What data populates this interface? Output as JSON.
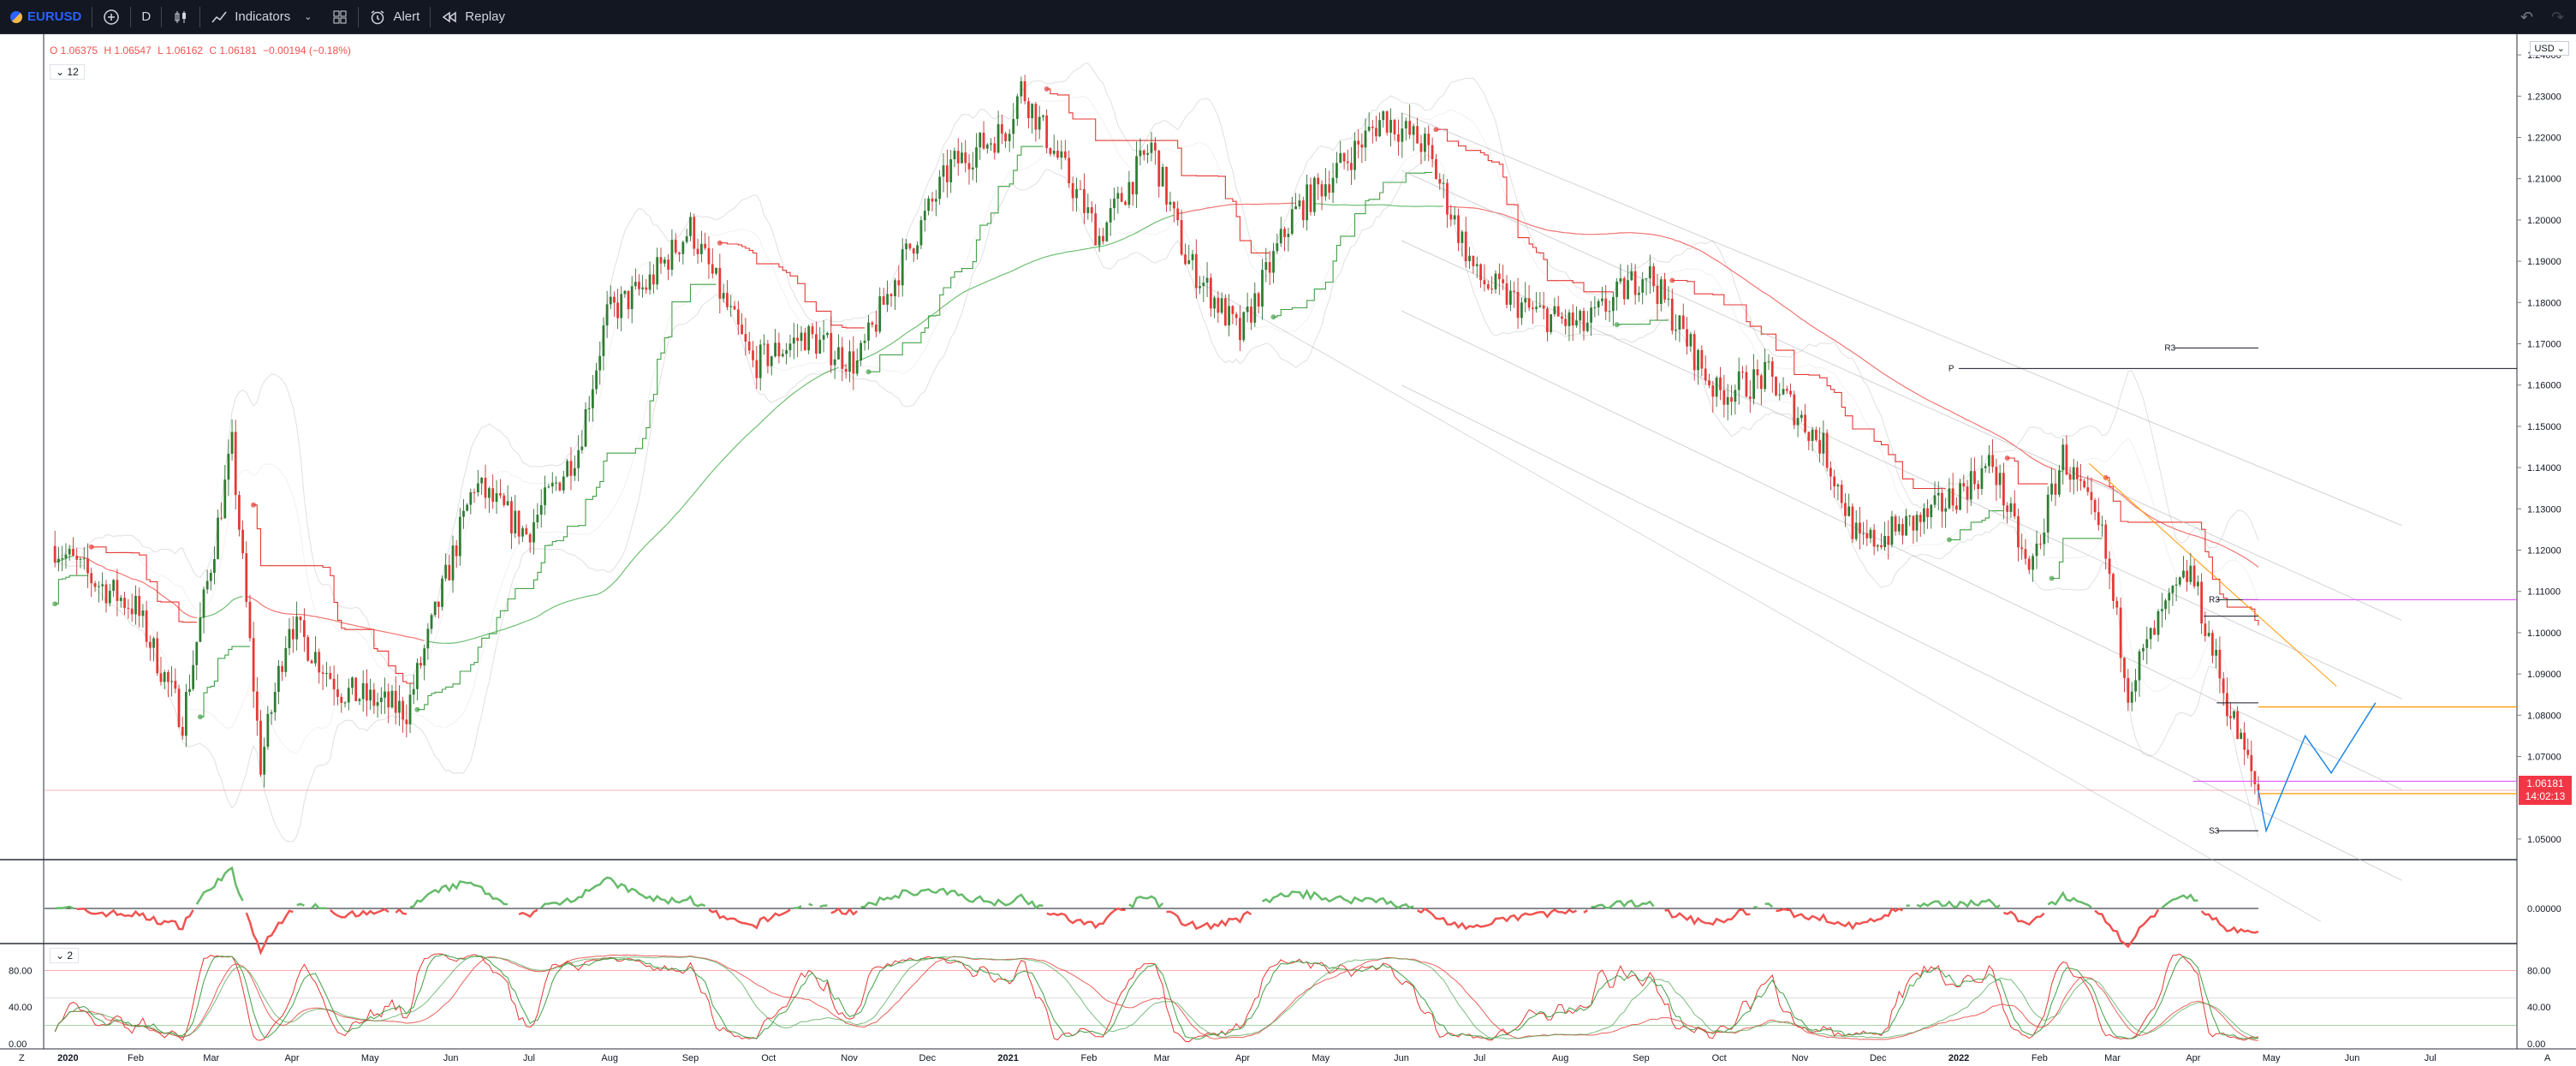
{
  "toolbar": {
    "symbol": "EURUSD",
    "interval": "D",
    "indicators_label": "Indicators",
    "alert_label": "Alert",
    "replay_label": "Replay"
  },
  "ohlc": {
    "o": "O 1.06375",
    "h": "H 1.06547",
    "l": "L 1.06162",
    "c": "C 1.06181",
    "chg": "−0.00194 (−0.18%)"
  },
  "legend_badge_main": "12",
  "legend_badge_stoch": "2",
  "currency": "USD",
  "last_price": {
    "value": "1.06181",
    "countdown": "14:02:13"
  },
  "colors": {
    "up": "#26a69a",
    "down": "#ef5350",
    "bar_up": "#2e7d32",
    "bar_down": "#e53935",
    "accent": "#2962ff",
    "toolbar_bg": "#131722"
  },
  "chart_data": [
    {
      "type": "candlestick",
      "symbol": "EURUSD",
      "ylim": [
        1.045,
        1.245
      ],
      "price_ticks": [
        "1.24000",
        "1.23000",
        "1.22000",
        "1.21000",
        "1.20000",
        "1.19000",
        "1.18000",
        "1.17000",
        "1.16000",
        "1.15000",
        "1.14000",
        "1.13000",
        "1.12000",
        "1.11000",
        "1.10000",
        "1.09000",
        "1.08000",
        "1.07000",
        "1.05000"
      ],
      "x_ticks": [
        "2020",
        "Feb",
        "Mar",
        "Apr",
        "May",
        "Jun",
        "Jul",
        "Aug",
        "Sep",
        "Oct",
        "Nov",
        "Dec",
        "2021",
        "Feb",
        "Mar",
        "Apr",
        "May",
        "Jun",
        "Jul",
        "Aug",
        "Sep",
        "Oct",
        "Nov",
        "Dec",
        "2022",
        "Feb",
        "Mar",
        "Apr",
        "May",
        "Jun",
        "Jul"
      ],
      "close_path": [
        [
          "2020-01-01",
          1.121
        ],
        [
          "2020-01-15",
          1.113
        ],
        [
          "2020-02-01",
          1.106
        ],
        [
          "2020-02-19",
          1.079
        ],
        [
          "2020-03-09",
          1.145
        ],
        [
          "2020-03-20",
          1.068
        ],
        [
          "2020-03-31",
          1.103
        ],
        [
          "2020-04-20",
          1.086
        ],
        [
          "2020-05-15",
          1.081
        ],
        [
          "2020-06-10",
          1.136
        ],
        [
          "2020-06-30",
          1.124
        ],
        [
          "2020-07-20",
          1.145
        ],
        [
          "2020-07-31",
          1.177
        ],
        [
          "2020-08-15",
          1.184
        ],
        [
          "2020-09-01",
          1.198
        ],
        [
          "2020-09-25",
          1.165
        ],
        [
          "2020-10-15",
          1.172
        ],
        [
          "2020-11-04",
          1.165
        ],
        [
          "2020-11-20",
          1.188
        ],
        [
          "2020-12-10",
          1.213
        ],
        [
          "2020-12-31",
          1.222
        ],
        [
          "2021-01-06",
          1.232
        ],
        [
          "2021-01-20",
          1.215
        ],
        [
          "2021-02-05",
          1.196
        ],
        [
          "2021-02-25",
          1.218
        ],
        [
          "2021-03-10",
          1.191
        ],
        [
          "2021-03-31",
          1.172
        ],
        [
          "2021-04-20",
          1.201
        ],
        [
          "2021-05-10",
          1.214
        ],
        [
          "2021-05-25",
          1.225
        ],
        [
          "2021-06-10",
          1.218
        ],
        [
          "2021-06-30",
          1.186
        ],
        [
          "2021-07-20",
          1.178
        ],
        [
          "2021-08-10",
          1.174
        ],
        [
          "2021-09-03",
          1.188
        ],
        [
          "2021-09-30",
          1.158
        ],
        [
          "2021-10-20",
          1.162
        ],
        [
          "2021-11-10",
          1.145
        ],
        [
          "2021-11-24",
          1.121
        ],
        [
          "2021-12-20",
          1.128
        ],
        [
          "2022-01-14",
          1.141
        ],
        [
          "2022-01-28",
          1.114
        ],
        [
          "2022-02-10",
          1.143
        ],
        [
          "2022-02-25",
          1.123
        ],
        [
          "2022-03-07",
          1.087
        ],
        [
          "2022-03-20",
          1.104
        ],
        [
          "2022-03-31",
          1.115
        ],
        [
          "2022-04-14",
          1.083
        ],
        [
          "2022-04-26",
          1.061
        ]
      ],
      "overlays": [
        "Bollinger bands",
        "moving averages",
        "supertrend",
        "regression channel"
      ],
      "levels": {
        "P": 1.164,
        "R3_upper": 1.169,
        "R3_lower": 1.108,
        "S3": 1.052,
        "magenta_1": 1.108,
        "magenta_2": 1.064,
        "orange": 1.082,
        "last": 1.06181
      },
      "projection": [
        [
          "2022-04-29",
          1.052
        ],
        [
          "2022-05-14",
          1.075
        ],
        [
          "2022-05-24",
          1.066
        ],
        [
          "2022-06-10",
          1.083
        ]
      ]
    },
    {
      "type": "line",
      "name": "",
      "ticks": [
        "0.00000"
      ]
    },
    {
      "type": "line",
      "name": "",
      "ticks": [
        "80.00",
        "40.00",
        "0.00"
      ]
    }
  ],
  "corner_labels": {
    "left": "Z",
    "right": "A"
  }
}
